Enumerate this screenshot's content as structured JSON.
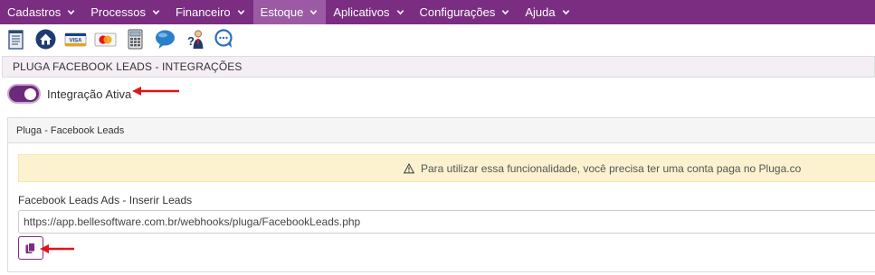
{
  "colors": {
    "menu_bg": "#7b2d82",
    "menu_active_bg": "#9b5aa3",
    "accent": "#6d2a7a",
    "arrow": "#e3141b",
    "alert_bg": "#fcf2cf"
  },
  "menu": {
    "items": [
      {
        "label": "Cadastros",
        "icon": "chevron-down-icon"
      },
      {
        "label": "Processos",
        "icon": "chevron-down-icon"
      },
      {
        "label": "Financeiro",
        "icon": "chevron-down-icon"
      },
      {
        "label": "Estoque",
        "icon": "chevron-down-icon",
        "active": true
      },
      {
        "label": "Aplicativos",
        "icon": "chevron-down-icon"
      },
      {
        "label": "Configurações",
        "icon": "chevron-down-icon"
      },
      {
        "label": "Ajuda",
        "icon": "chevron-down-icon"
      }
    ]
  },
  "toolbar": {
    "icons": [
      "notepad-icon",
      "home-icon",
      "visa-card-icon",
      "mastercard-icon",
      "calculator-icon",
      "chat-bubble-icon",
      "support-person-icon",
      "help-chat-icon"
    ]
  },
  "page": {
    "title": "PLUGA FACEBOOK LEADS - INTEGRAÇÕES"
  },
  "integration": {
    "toggle_label": "Integração Ativa",
    "active": true
  },
  "panel": {
    "heading": "Pluga - Facebook Leads",
    "alert_text": "Para utilizar essa funcionalidade, você precisa ter uma conta paga no Pluga.co",
    "alert_icon": "warning-icon",
    "field_label": "Facebook Leads Ads - Inserir Leads",
    "webhook_url": "https://app.bellesoftware.com.br/webhooks/pluga/FacebookLeads.php",
    "copy_icon": "copy-icon"
  }
}
